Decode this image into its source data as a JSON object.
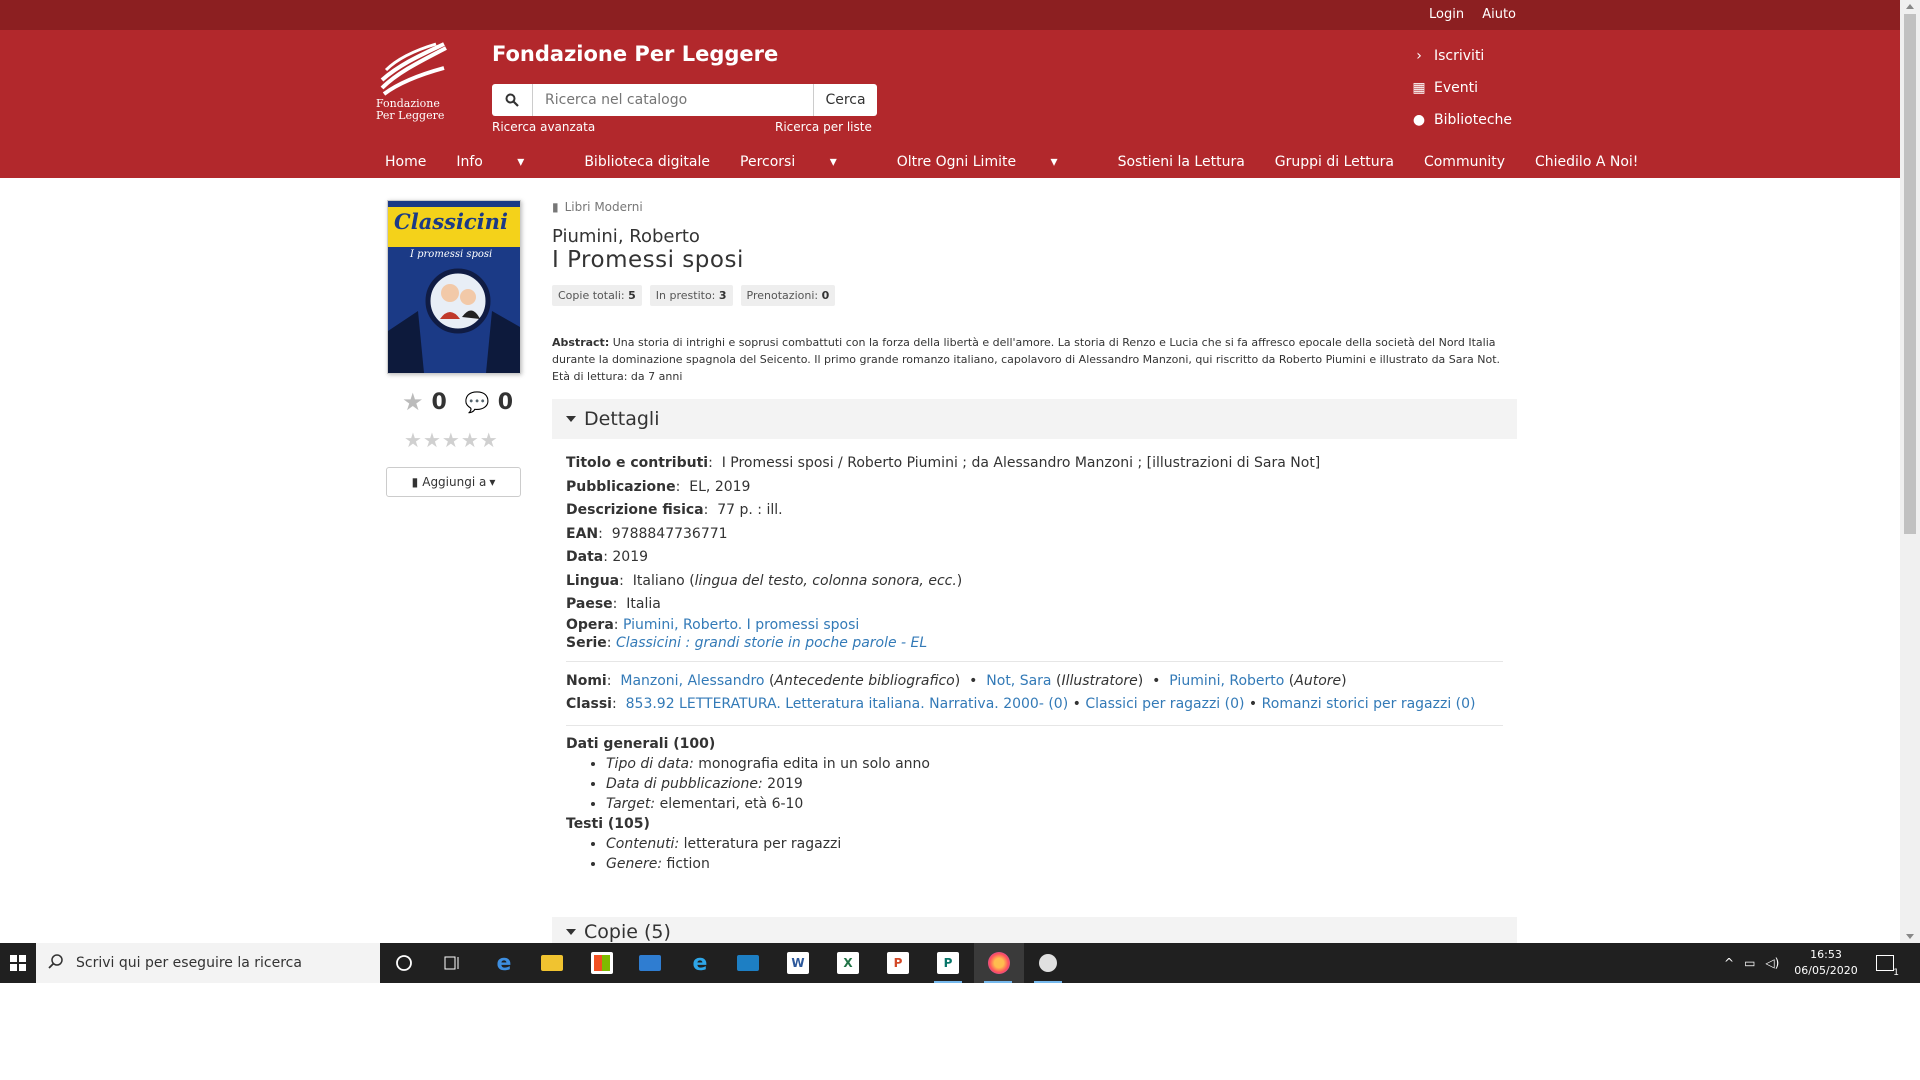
{
  "topbar": {
    "login": "Login",
    "help": "Aiuto"
  },
  "header": {
    "site_title": "Fondazione Per Leggere",
    "logo_line1": "Fondazione",
    "logo_line2": "Per Leggere",
    "search_placeholder": "Ricerca nel catalogo",
    "search_button": "Cerca",
    "advanced_search": "Ricerca avanzata",
    "list_search": "Ricerca per liste",
    "right_links": [
      "Iscriviti",
      "Eventi",
      "Biblioteche"
    ]
  },
  "nav": [
    "Home",
    "Info",
    "Biblioteca digitale",
    "Percorsi",
    "Oltre Ogni Limite",
    "Sostieni la Lettura",
    "Gruppi di Lettura",
    "Community",
    "Chiedilo A Noi!"
  ],
  "book": {
    "cover_title": "Classicini",
    "cover_subtitle": "I promessi sposi",
    "rating_count": "0",
    "comment_count": "0",
    "rating": 0,
    "add_to": "Aggiungi a",
    "type": "Libri Moderni",
    "author": "Piumini, Roberto",
    "title": "I Promessi sposi",
    "badges": {
      "total_label": "Copie totali:",
      "total": "5",
      "loan_label": "In prestito:",
      "loan": "3",
      "res_label": "Prenotazioni:",
      "res": "0"
    },
    "abstract_label": "Abstract:",
    "abstract_text": "Una storia di intrighi e soprusi combattuti con la forza della libertà e dell'amore. La storia di Renzo e Lucia che si fa affresco epocale della società del Nord Italia durante la dominazione spagnola del Seicento. Il primo grande romanzo italiano, capolavoro di Alessandro Manzoni, qui riscritto da Roberto Piumini e illustrato da Sara Not. Età di lettura: da 7 anni"
  },
  "details": {
    "heading": "Dettagli",
    "title_label": "Titolo e contributi",
    "title_value": "I Promessi sposi / Roberto Piumini ; da Alessandro Manzoni ; [illustrazioni di Sara Not]",
    "pub_label": "Pubblicazione",
    "pub_value": "EL, 2019",
    "phys_label": "Descrizione fisica",
    "phys_value": "77 p. : ill.",
    "ean_label": "EAN",
    "ean_value": "9788847736771",
    "date_label": "Data",
    "date_value": "2019",
    "lang_label": "Lingua",
    "lang_value": "Italiano",
    "lang_note": "lingua del testo, colonna sonora, ecc.",
    "country_label": "Paese",
    "country_value": "Italia",
    "opera_label": "Opera",
    "opera_value": "Piumini, Roberto. I promessi sposi",
    "serie_label": "Serie",
    "serie_value": "Classicini : grandi storie in poche parole - EL",
    "names_label": "Nomi",
    "names": [
      {
        "name": "Manzoni, Alessandro",
        "role": "Antecedente bibliografico"
      },
      {
        "name": "Not, Sara",
        "role": "Illustratore"
      },
      {
        "name": "Piumini, Roberto",
        "role": "Autore"
      }
    ],
    "classes_label": "Classi",
    "classes": [
      "853.92 LETTERATURA. Letteratura italiana. Narrativa. 2000- (0)",
      "Classici per ragazzi (0)",
      "Romanzi storici per ragazzi (0)"
    ],
    "general_heading": "Dati generali (100)",
    "general_items": [
      {
        "label": "Tipo di data:",
        "value": "monografia edita in un solo anno"
      },
      {
        "label": "Data di pubblicazione:",
        "value": "2019"
      },
      {
        "label": "Target:",
        "value": "elementari, età 6-10"
      }
    ],
    "texts_heading": "Testi (105)",
    "texts_items": [
      {
        "label": "Contenuti:",
        "value": "letteratura per ragazzi"
      },
      {
        "label": "Genere:",
        "value": "fiction"
      }
    ]
  },
  "copies_heading": "Copie (5)",
  "taskbar": {
    "search_text": "Scrivi qui per eseguire la ricerca",
    "time": "16:53",
    "date": "06/05/2020",
    "notifications": "1"
  },
  "colors": {
    "header": "#b2282c",
    "topbar": "#8c1f21",
    "link": "#337ab7"
  }
}
